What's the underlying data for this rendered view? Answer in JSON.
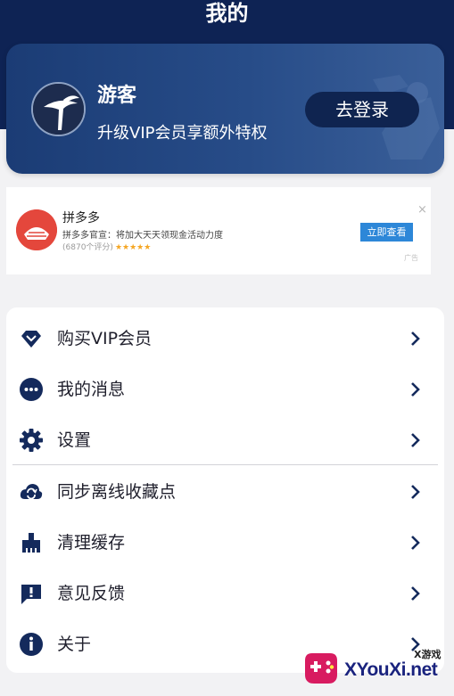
{
  "header": {
    "title": "我的"
  },
  "profile": {
    "name": "游客",
    "tagline": "升级VIP会员享额外特权",
    "login_label": "去登录"
  },
  "ad": {
    "app_name": "拼多多",
    "description": "拼多多官宣：将加大天天领现金活动力度",
    "rating": "(6870个评分)",
    "stars": "★★★★★",
    "cta_label": "立即查看",
    "close_glyph": "×",
    "ad_mark": "广告"
  },
  "menu": {
    "items": [
      {
        "label": "购买VIP会员",
        "icon": "diamond-icon"
      },
      {
        "label": "我的消息",
        "icon": "message-dots-icon"
      },
      {
        "label": "设置",
        "icon": "gear-icon"
      },
      {
        "label": "同步离线收藏点",
        "icon": "cloud-sync-icon"
      },
      {
        "label": "清理缓存",
        "icon": "broom-icon"
      },
      {
        "label": "意见反馈",
        "icon": "feedback-icon"
      },
      {
        "label": "关于",
        "icon": "info-icon"
      }
    ]
  },
  "watermark": {
    "small_text": "X游戏",
    "main_text": "XYouXi.net"
  },
  "colors": {
    "header_bg": "#0e2354",
    "card_bg": "#274c88",
    "icon_navy": "#142a5c",
    "ad_cta": "#2d87d8"
  }
}
